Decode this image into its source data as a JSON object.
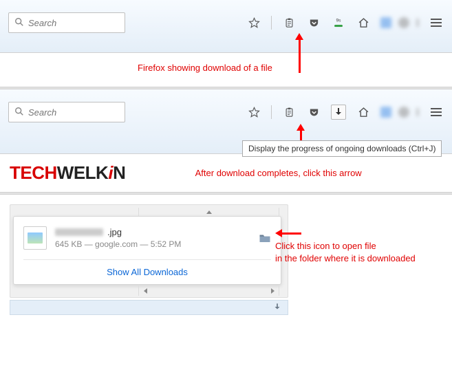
{
  "search": {
    "placeholder": "Search"
  },
  "icons": {
    "star": "star-icon",
    "clipboard": "clipboard-icon",
    "pocket": "pocket-icon",
    "download_progress": "download-progress-icon",
    "download_arrow": "download-arrow-icon",
    "home": "home-icon",
    "menu": "menu-icon",
    "folder": "folder-icon"
  },
  "download_progress_badge": "9s",
  "captions": {
    "first": "Firefox showing download of a file",
    "second": "After download completes, click this arrow",
    "side_line1": "Click this icon to open file",
    "side_line2": "in the folder where it is downloaded"
  },
  "tooltip": "Display the progress of ongoing downloads (Ctrl+J)",
  "brand": {
    "tech": "TECH",
    "welk": "WELK",
    "i": "i",
    "n": "N"
  },
  "download_item": {
    "ext": ".jpg",
    "meta": "645 KB — google.com — 5:52 PM"
  },
  "popup_footer": "Show All Downloads"
}
